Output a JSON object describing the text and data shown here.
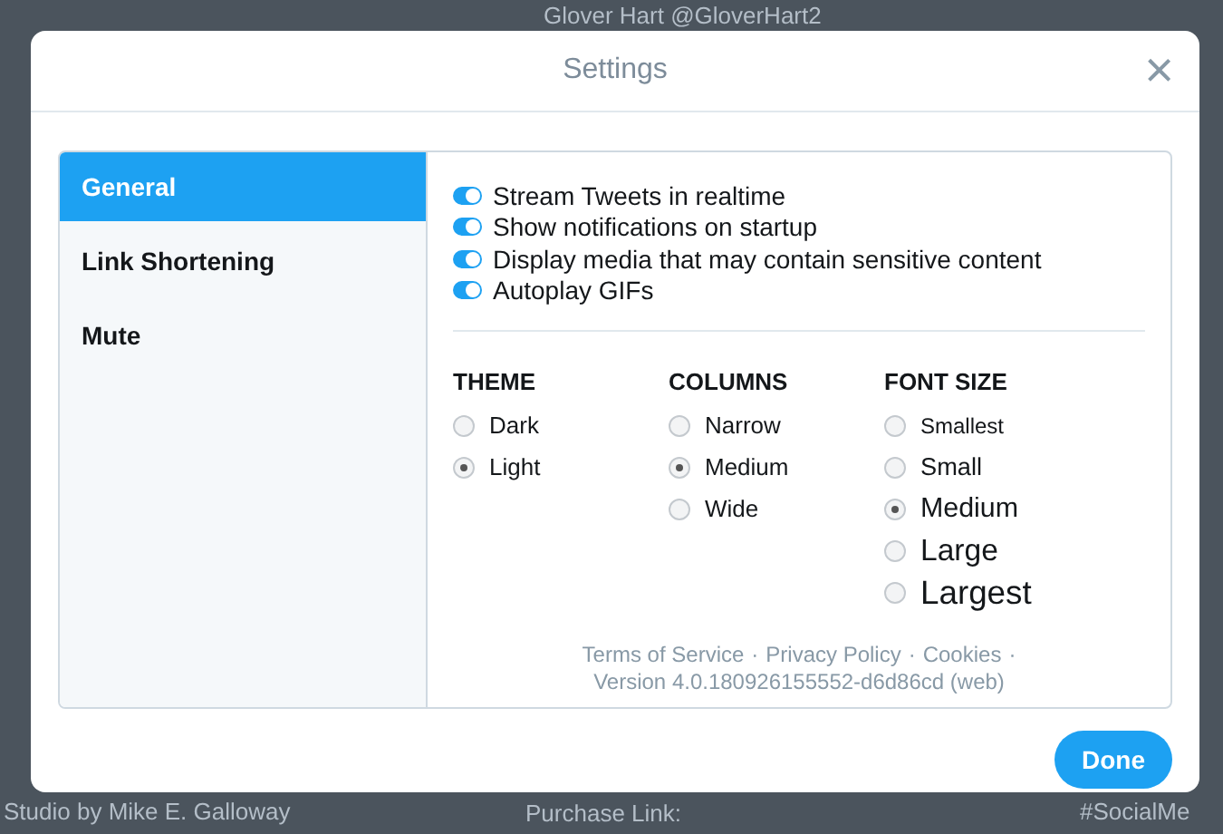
{
  "backdrop": {
    "texts": [
      "Glover Hart @GloverHart2",
      "Studio by Mike E. Galloway",
      "Purchase Link:",
      "#SocialMe"
    ]
  },
  "dialog": {
    "title": "Settings",
    "close": "×"
  },
  "sidebar": {
    "items": [
      {
        "label": "General",
        "selected": true
      },
      {
        "label": "Link Shortening",
        "selected": false
      },
      {
        "label": "Mute",
        "selected": false
      }
    ]
  },
  "toggles": [
    {
      "label": "Stream Tweets in realtime",
      "on": true
    },
    {
      "label": "Show notifications on startup",
      "on": true
    },
    {
      "label": "Display media that may contain sensitive content",
      "on": true
    },
    {
      "label": "Autoplay GIFs",
      "on": true
    }
  ],
  "groups": [
    {
      "heading": "THEME",
      "options": [
        {
          "label": "Dark",
          "selected": false
        },
        {
          "label": "Light",
          "selected": true
        }
      ]
    },
    {
      "heading": "COLUMNS",
      "options": [
        {
          "label": "Narrow",
          "selected": false
        },
        {
          "label": "Medium",
          "selected": true
        },
        {
          "label": "Wide",
          "selected": false
        }
      ]
    },
    {
      "heading": "FONT SIZE",
      "kind": "scaled",
      "options": [
        {
          "label": "Smallest",
          "selected": false
        },
        {
          "label": "Small",
          "selected": false
        },
        {
          "label": "Medium",
          "selected": true
        },
        {
          "label": "Large",
          "selected": false
        },
        {
          "label": "Largest",
          "selected": false
        }
      ]
    }
  ],
  "footer": {
    "links": [
      "Terms of Service",
      "Privacy Policy",
      "Cookies"
    ],
    "separator": "·",
    "version": "Version 4.0.180926155552-d6d86cd (web)"
  },
  "done_button": "Done"
}
